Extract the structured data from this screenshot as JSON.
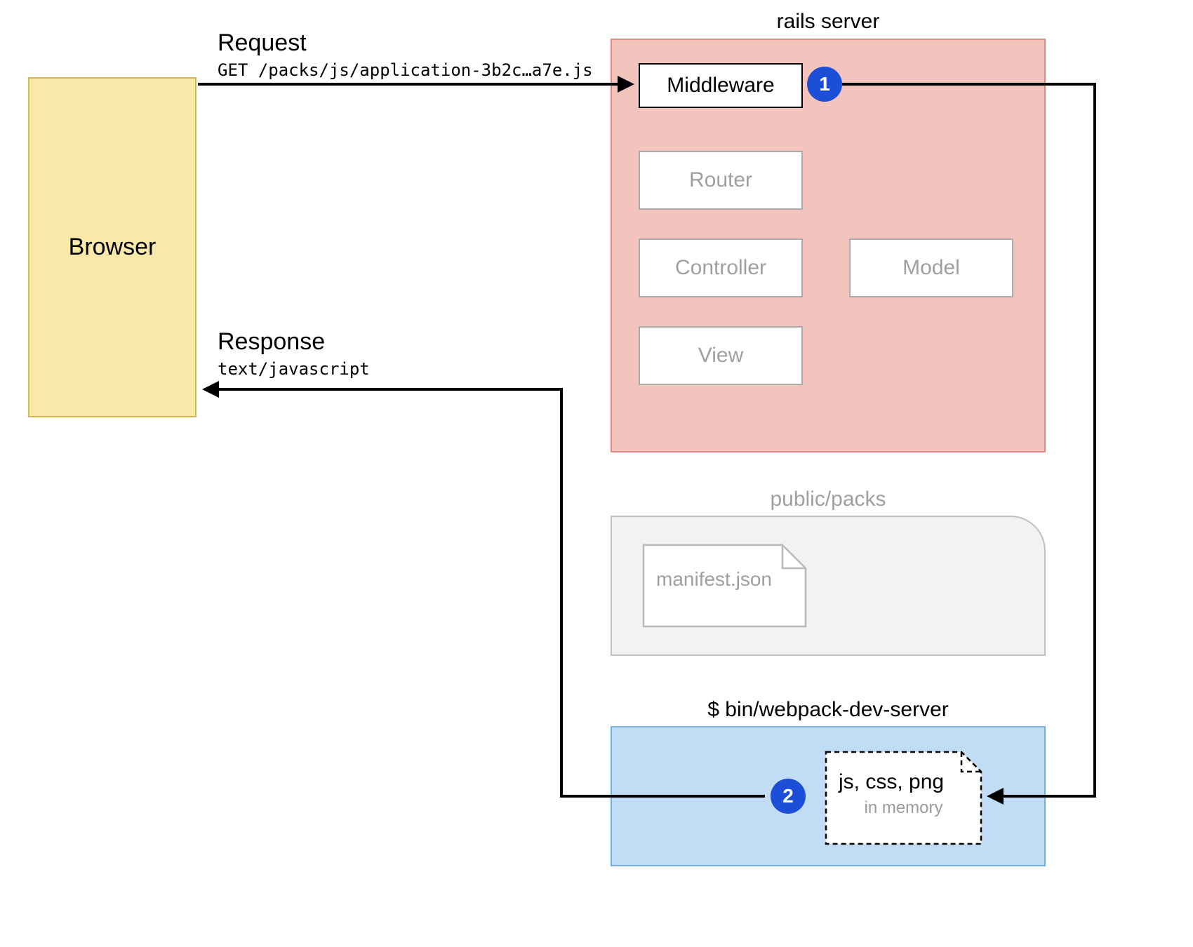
{
  "browser": {
    "label": "Browser"
  },
  "request": {
    "title": "Request",
    "subtitle": "GET /packs/js/application-3b2c…a7e.js"
  },
  "response": {
    "title": "Response",
    "subtitle": "text/javascript"
  },
  "rails": {
    "title": "rails server",
    "middleware": "Middleware",
    "router": "Router",
    "controller": "Controller",
    "model": "Model",
    "view": "View"
  },
  "packs": {
    "title": "public/packs",
    "manifest": "manifest.json"
  },
  "devserver": {
    "title": "$ bin/webpack-dev-server",
    "files_label": "js, css, png",
    "files_sub": "in memory"
  },
  "badges": {
    "one": "1",
    "two": "2"
  }
}
